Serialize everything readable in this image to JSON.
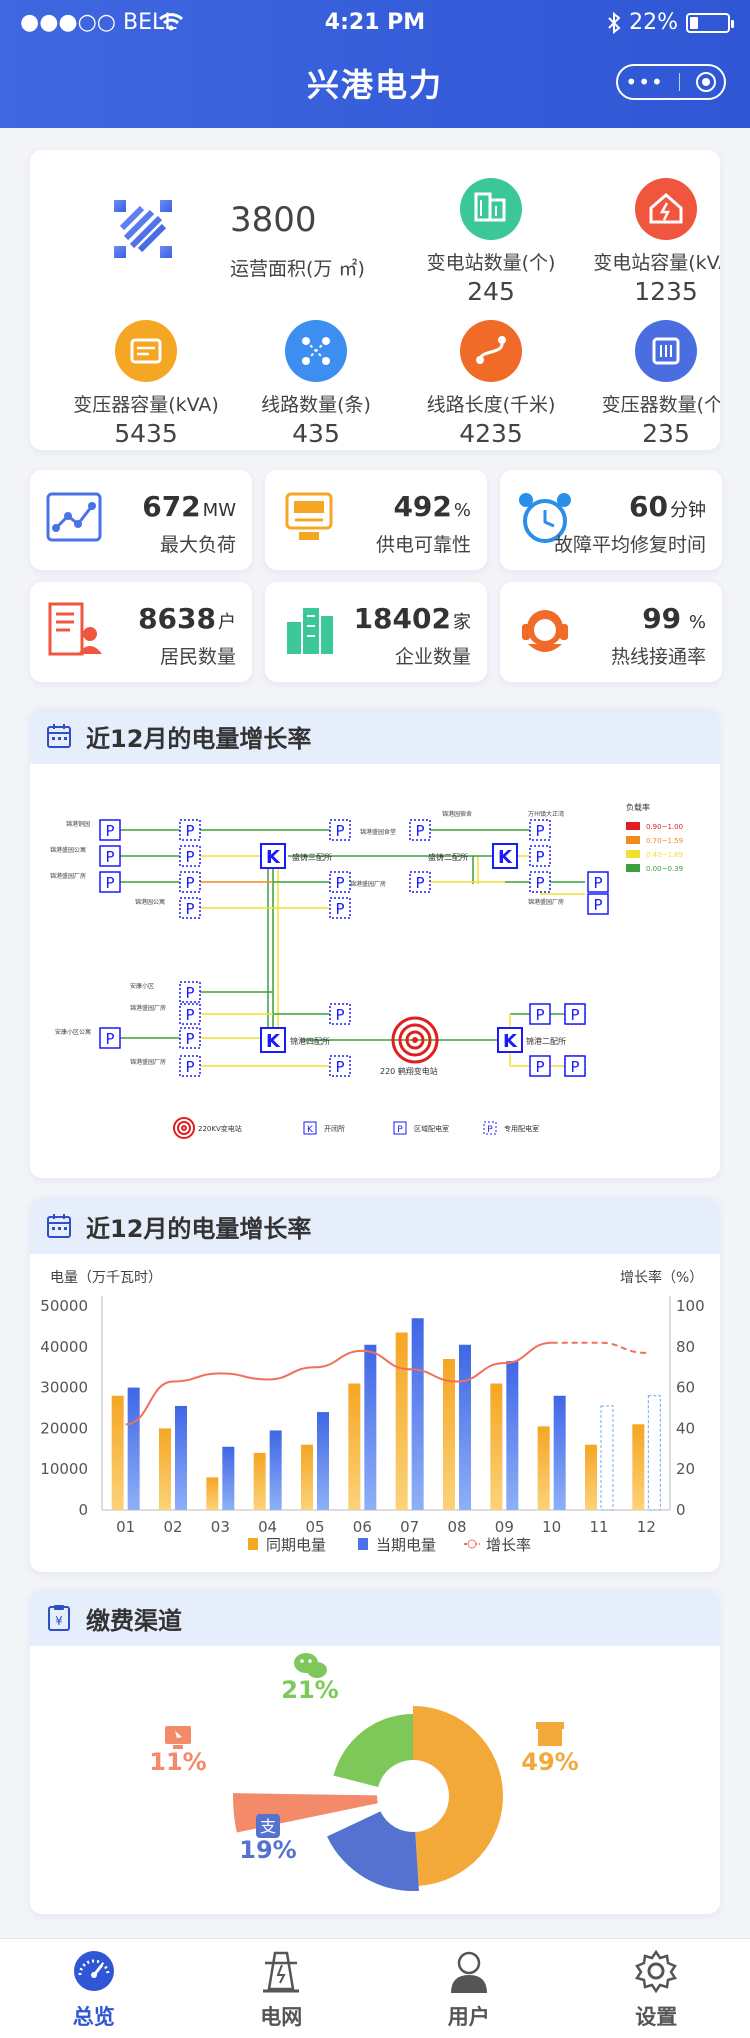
{
  "status": {
    "carrier": "●●●○○ BELL",
    "time": "4:21 PM",
    "battery": "22%",
    "battery_level": 0.22
  },
  "header": {
    "title": "兴港电力"
  },
  "overview": {
    "area": {
      "value": "3800",
      "label": "运营面积(万 ㎡)"
    },
    "items": [
      {
        "label": "变电站数量(个)",
        "value": "245",
        "color": "#3cc79a",
        "icon": "building-icon"
      },
      {
        "label": "变电站容量(kVA)",
        "value": "1235",
        "color": "#f0553d",
        "icon": "house-power-icon"
      },
      {
        "label": "变压器容量(kVA)",
        "value": "5435",
        "color": "#f5a623",
        "icon": "wallet-icon"
      },
      {
        "label": "线路数量(条)",
        "value": "435",
        "color": "#3c8ef0",
        "icon": "network-icon"
      },
      {
        "label": "线路长度(千米)",
        "value": "4235",
        "color": "#f06a28",
        "icon": "route-icon"
      },
      {
        "label": "变压器数量(个)",
        "value": "235",
        "color": "#4a6ee0",
        "icon": "chip-icon"
      }
    ]
  },
  "kpis": [
    {
      "num": "672",
      "unit": "MW",
      "label": "最大负荷",
      "icon": "line-chart-icon"
    },
    {
      "num": "492",
      "unit": "%",
      "label": "供电可靠性",
      "icon": "monitor-icon"
    },
    {
      "num": "60",
      "unit": "分钟",
      "label": "故障平均修复时间",
      "icon": "alarm-clock-icon"
    },
    {
      "num": "8638",
      "unit": "户",
      "label": "居民数量",
      "icon": "residents-icon"
    },
    {
      "num": "18402",
      "unit": "家",
      "label": "企业数量",
      "icon": "enterprise-building-icon"
    },
    {
      "num": "99",
      "unit": " %",
      "label": "热线接通率",
      "icon": "headset-icon"
    }
  ],
  "diagram": {
    "title": "近12月的电量增长率",
    "legend_title": "负载率",
    "legend": [
      {
        "color": "#e02020",
        "label": "0.90~1.00"
      },
      {
        "color": "#f08c1e",
        "label": "0.70~1.59"
      },
      {
        "color": "#f2e030",
        "label": "0.40~1.69"
      },
      {
        "color": "#3aa03a",
        "label": "0.00~0.39"
      }
    ],
    "station_labels": {
      "k1": "盛铸三配所",
      "k2": "盛铸二配所",
      "k3": "锦港四配所",
      "k4": "锦港二配所",
      "sub": "220 鹤翔变电站"
    },
    "bottom_legend": [
      "220KV变电站",
      "开闭所",
      "区域配电室",
      "专用配电室"
    ],
    "tiny": [
      "锦港铜园",
      "锦港盛园公寓",
      "锦港盛园厂房",
      "锦港园公寓",
      "锦港盛园食堂",
      "锦港盛园厂房",
      "锦港园宿舍",
      "万州镇大正湾",
      "锦港盛园厂房",
      "安康小区",
      "锦港盛园厂房",
      "安康小区公寓",
      "锦港盛园厂房"
    ]
  },
  "chart_title": "近12月的电量增长率",
  "chart_data": {
    "type": "bar",
    "categories": [
      "01",
      "02",
      "03",
      "04",
      "05",
      "06",
      "07",
      "08",
      "09",
      "10",
      "11",
      "12"
    ],
    "series": [
      {
        "name": "同期电量",
        "type": "bar",
        "color": "#f5a623",
        "values": [
          28000,
          20000,
          8000,
          14000,
          16000,
          31000,
          43500,
          37000,
          31000,
          20500,
          16000,
          21000
        ]
      },
      {
        "name": "当期电量",
        "type": "bar",
        "color": "#4a72e8",
        "values": [
          30000,
          25500,
          15500,
          19500,
          24000,
          40500,
          47000,
          40500,
          36500,
          28000,
          25500,
          28000
        ]
      },
      {
        "name": "增长率",
        "type": "line",
        "color": "#f0705a",
        "values": [
          42,
          63,
          67,
          64,
          70,
          78,
          69,
          63,
          72,
          82,
          82,
          77
        ]
      }
    ],
    "ylabel": "电量（万千瓦时）",
    "y2label": "增长率（%）",
    "ylim": [
      0,
      50000
    ],
    "y2lim": [
      0,
      100
    ],
    "yticks": [
      "0",
      "10000",
      "20000",
      "30000",
      "40000",
      "50000"
    ],
    "y2ticks": [
      "0",
      "20",
      "40",
      "60",
      "80",
      "100"
    ],
    "legend": "bottom"
  },
  "payment": {
    "title": "缴费渠道",
    "slices": [
      {
        "label": "49%",
        "value": 49,
        "color": "#f3a93a",
        "icon": "store-icon"
      },
      {
        "label": "19%",
        "value": 19,
        "color": "#5572d0",
        "icon": "alipay-icon"
      },
      {
        "label": "11%",
        "value": 11,
        "color": "#f38a6a",
        "icon": "computer-icon"
      },
      {
        "label": "21%",
        "value": 21,
        "color": "#7ec85a",
        "icon": "wechat-icon"
      }
    ]
  },
  "tabs": [
    {
      "label": "总览",
      "icon": "dashboard-gauge-icon",
      "active": true
    },
    {
      "label": "电网",
      "icon": "power-tower-icon",
      "active": false
    },
    {
      "label": "用户",
      "icon": "user-icon",
      "active": false
    },
    {
      "label": "设置",
      "icon": "gear-icon",
      "active": false
    }
  ]
}
